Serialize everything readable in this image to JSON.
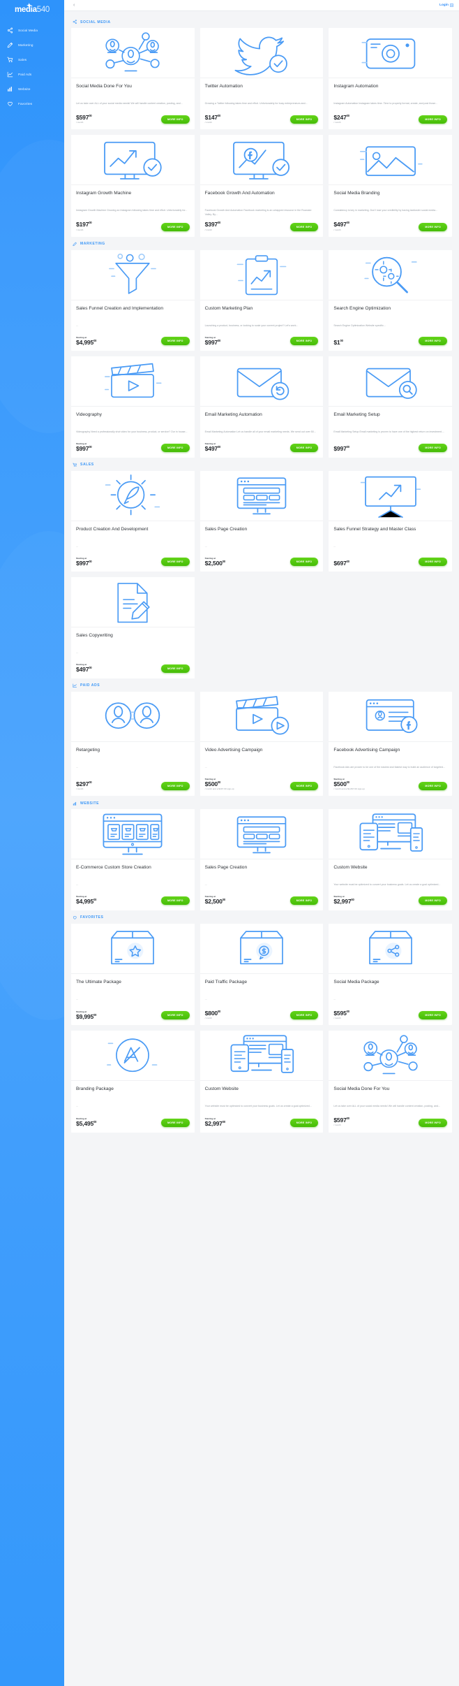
{
  "brand": {
    "part1": "media",
    "part2": "540",
    "star_icon": "star-icon"
  },
  "sidebar": {
    "items": [
      {
        "label": "Social Media",
        "icon": "share-icon"
      },
      {
        "label": "Marketing",
        "icon": "pencil-icon"
      },
      {
        "label": "Sales",
        "icon": "cart-icon"
      },
      {
        "label": "Paid Ads",
        "icon": "chart-line-icon"
      },
      {
        "label": "Website",
        "icon": "bar-chart-icon"
      },
      {
        "label": "Favorites",
        "icon": "heart-icon"
      }
    ]
  },
  "header": {
    "collapse_icon": "chevron-left-icon",
    "login_label": "Login",
    "login_icon": "login-arrow-icon"
  },
  "colors": {
    "accent_blue": "#3c97f7",
    "sidebar_blue": "#3a9afc",
    "button_green": "#45bc07",
    "text_dark": "#2f3338",
    "text_muted": "#9aa0a7",
    "page_bg": "#f4f5f7"
  },
  "more_info_label": "MORE INFO",
  "sections": [
    {
      "title": "SOCIAL MEDIA",
      "icon": "share-icon",
      "cards": [
        {
          "art": "network-people-icon",
          "title": "Social Media Done For You",
          "desc": "Let us take over ALL of your social media needs!  We will handle content creation, posting, and...",
          "price_pre": "",
          "price": "$597",
          "cents": "00",
          "price_post": "/ month"
        },
        {
          "art": "twitter-bird-icon",
          "title": "Twitter Automation",
          "desc": "Growing a Twitter following takes time and effort. Unfortunately for busy entrepreneurs and...",
          "price_pre": "",
          "price": "$147",
          "cents": "00",
          "price_post": "/ month"
        },
        {
          "art": "instagram-camera-icon",
          "title": "Instagram Automation",
          "desc": "Instagram Automation   Instagram takes time. Time to properly format, create, and post those...",
          "price_pre": "",
          "price": "$247",
          "cents": "00",
          "price_post": "/ month"
        },
        {
          "art": "monitor-growth-icon",
          "title": "Instagram Growth Machine",
          "desc": "Instagram Growth Machine Growing an Instagram following takes time and effort. Unfortunately for...",
          "price_pre": "",
          "price": "$197",
          "cents": "00",
          "price_post": "/ month"
        },
        {
          "art": "facebook-growth-icon",
          "title": "Facebook Growth And Automation",
          "desc": "Facebook Growth And Automation Facebook marketing is an untapped resource in the Roanoke Valley. By...",
          "price_pre": "",
          "price": "$397",
          "cents": "00",
          "price_post": "/ month"
        },
        {
          "art": "image-branding-icon",
          "title": "Social Media Branding",
          "desc": "Consistency is key in marketing. Don't lose your credibility by having lackluster social media...",
          "price_pre": "",
          "price": "$497",
          "cents": "00",
          "price_post": "/ month"
        }
      ]
    },
    {
      "title": "MARKETING",
      "icon": "pencil-icon",
      "cards": [
        {
          "art": "funnel-icon",
          "title": "Sales Funnel Creation and Implementation",
          "desc": "...",
          "price_pre": "Starting at",
          "price": "$4,995",
          "cents": "00",
          "price_post": ""
        },
        {
          "art": "clipboard-chart-icon",
          "title": "Custom Marketing Plan",
          "desc": "Launching a product, business, or looking to scale your current project?  Let's work...",
          "price_pre": "Starting at",
          "price": "$997",
          "cents": "00",
          "price_post": ""
        },
        {
          "art": "magnifier-gear-icon",
          "title": "Search Engine Optimization",
          "desc": "Search Engine Optimization Website specific...",
          "price_pre": "",
          "price": "$1",
          "cents": "00",
          "price_post": ""
        },
        {
          "art": "clapperboard-icon",
          "title": "Videography",
          "desc": "Videography Need a professionally shot video for your business, product, or service? Our in house...",
          "price_pre": "Starting at",
          "price": "$997",
          "cents": "00",
          "price_post": ""
        },
        {
          "art": "envelope-refresh-icon",
          "title": "Email Marketing Automation",
          "desc": "Email Marketing Automation Let us handle all of your email marketing needs. We send out over 50...",
          "price_pre": "Starting at",
          "price": "$497",
          "cents": "00",
          "price_post": ""
        },
        {
          "art": "envelope-search-icon",
          "title": "Email Marketing Setup",
          "desc": "Email Marketing Setup Email marketing is proven to have one of the highest return on investment....",
          "price_pre": "",
          "price": "$997",
          "cents": "00",
          "price_post": ""
        }
      ]
    },
    {
      "title": "SALES",
      "icon": "cart-icon",
      "cards": [
        {
          "art": "gear-rocket-icon",
          "title": "Product Creation And Development",
          "desc": "...",
          "price_pre": "Starting at",
          "price": "$997",
          "cents": "00",
          "price_post": ""
        },
        {
          "art": "monitor-page-icon",
          "title": "Sales Page Creation",
          "desc": "...",
          "price_pre": "Starting at",
          "price": "$2,500",
          "cents": "00",
          "price_post": ""
        },
        {
          "art": "presentation-board-icon",
          "title": "Sales Funnel Strategy and Master Class",
          "desc": "...",
          "price_pre": "",
          "price": "$697",
          "cents": "00",
          "price_post": ""
        },
        {
          "art": "document-pen-icon",
          "title": "Sales Copywriting",
          "desc": "...",
          "price_pre": "Starting at",
          "price": "$497",
          "cents": "00",
          "price_post": ""
        }
      ]
    },
    {
      "title": "PAID ADS",
      "icon": "chart-line-icon",
      "cards": [
        {
          "art": "two-users-icon",
          "title": "Retargeting",
          "desc": "...",
          "price_pre": "",
          "price": "$297",
          "cents": "00",
          "price_post": "/ month"
        },
        {
          "art": "clapperboard-play-icon",
          "title": "Video Advertising Campaign",
          "desc": "...",
          "price_pre": "Starting at",
          "price": "$500",
          "cents": "00",
          "price_post": "/ month and a $497.00 sign-up"
        },
        {
          "art": "browser-profile-icon",
          "title": "Facebook Advertising Campaign",
          "desc": "Facebook Ads are proven to be one of the easiest and fastest way to build an audience of targeted...",
          "price_pre": "Starting at",
          "price": "$500",
          "cents": "00",
          "price_post": "/ month and a $1,897.00 sign-up"
        }
      ]
    },
    {
      "title": "WEBSITE",
      "icon": "bar-chart-icon",
      "cards": [
        {
          "art": "ecommerce-monitor-icon",
          "title": "E-Commerce Custom Store Creation",
          "desc": "...",
          "price_pre": "Starting at",
          "price": "$4,995",
          "cents": "00",
          "price_post": ""
        },
        {
          "art": "monitor-page-icon",
          "title": "Sales Page Creation",
          "desc": "...",
          "price_pre": "Starting at",
          "price": "$2,500",
          "cents": "00",
          "price_post": ""
        },
        {
          "art": "responsive-devices-icon",
          "title": "Custom Website",
          "desc": "Your website must be optimized to convert your business goals.  Let us create a goal optimized...",
          "price_pre": "Starting at",
          "price": "$2,997",
          "cents": "00",
          "price_post": ""
        }
      ]
    },
    {
      "title": "FAVORITES",
      "icon": "heart-icon",
      "cards": [
        {
          "art": "box-star-icon",
          "title": "The Ultimate Package",
          "desc": "...",
          "price_pre": "Starting at",
          "price": "$9,995",
          "cents": "00",
          "price_post": ""
        },
        {
          "art": "box-money-icon",
          "title": "Paid Traffic Package",
          "desc": "...",
          "price_pre": "",
          "price": "$800",
          "cents": "00",
          "price_post": "/ month"
        },
        {
          "art": "box-share-icon",
          "title": "Social Media Package",
          "desc": "...",
          "price_pre": "",
          "price": "$595",
          "cents": "00",
          "price_post": "/ month"
        },
        {
          "art": "branding-package-icon",
          "title": "Branding Package",
          "desc": "...",
          "price_pre": "Starting at",
          "price": "$5,495",
          "cents": "00",
          "price_post": ""
        },
        {
          "art": "responsive-devices-icon",
          "title": "Custom Website",
          "desc": "Your website must be optimized to convert your business goals.  Let us create a goal optimized...",
          "price_pre": "Starting at",
          "price": "$2,997",
          "cents": "00",
          "price_post": ""
        },
        {
          "art": "network-people-icon",
          "title": "Social Media Done For You",
          "desc": "Let us take over ALL of your social media needs!  We will handle content creation, posting, and...",
          "price_pre": "",
          "price": "$597",
          "cents": "00",
          "price_post": "/ month"
        }
      ]
    }
  ]
}
